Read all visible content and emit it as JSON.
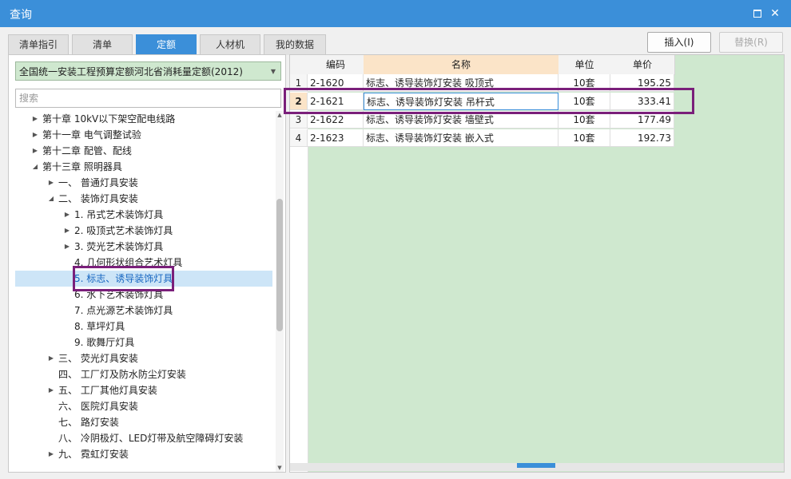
{
  "window": {
    "title": "查询",
    "title_bar_color": "#3b8fd9"
  },
  "tabs": [
    {
      "label": "清单指引",
      "active": false
    },
    {
      "label": "清单",
      "active": false
    },
    {
      "label": "定额",
      "active": true
    },
    {
      "label": "人材机",
      "active": false
    },
    {
      "label": "我的数据",
      "active": false
    }
  ],
  "toolbar": {
    "insert_label": "插入(I)",
    "replace_label": "替换(R)"
  },
  "library": {
    "selected": "全国统一安装工程预算定额河北省消耗量定额(2012)"
  },
  "search": {
    "placeholder": "搜索"
  },
  "tree": [
    {
      "label": "第十章 10kV以下架空配电线路",
      "expander": "collapsed"
    },
    {
      "label": "第十一章 电气调整试验",
      "expander": "collapsed"
    },
    {
      "label": "第十二章 配管、配线",
      "expander": "collapsed"
    },
    {
      "label": "第十三章 照明器具",
      "expander": "expanded"
    },
    {
      "label": "一、 普通灯具安装",
      "expander": "collapsed"
    },
    {
      "label": "二、 装饰灯具安装",
      "expander": "expanded"
    },
    {
      "label": "1. 吊式艺术装饰灯具",
      "expander": "collapsed"
    },
    {
      "label": "2. 吸顶式艺术装饰灯具",
      "expander": "collapsed"
    },
    {
      "label": "3. 荧光艺术装饰灯具",
      "expander": "collapsed"
    },
    {
      "label": "4. 几何形状组合艺术灯具",
      "expander": "none"
    },
    {
      "label": "5. 标志、诱导装饰灯具",
      "expander": "none",
      "selected": true
    },
    {
      "label": "6. 水下艺术装饰灯具",
      "expander": "none"
    },
    {
      "label": "7. 点光源艺术装饰灯具",
      "expander": "none"
    },
    {
      "label": "8. 草坪灯具",
      "expander": "none"
    },
    {
      "label": "9. 歌舞厅灯具",
      "expander": "none"
    },
    {
      "label": "三、 荧光灯具安装",
      "expander": "collapsed"
    },
    {
      "label": "四、 工厂灯及防水防尘灯安装",
      "expander": "none"
    },
    {
      "label": "五、 工厂其他灯具安装",
      "expander": "collapsed"
    },
    {
      "label": "六、 医院灯具安装",
      "expander": "none"
    },
    {
      "label": "七、 路灯安装",
      "expander": "none"
    },
    {
      "label": "八、 冷阴极灯、LED灯带及航空障碍灯安装",
      "expander": "none"
    },
    {
      "label": "九、 霓虹灯安装",
      "expander": "collapsed"
    }
  ],
  "grid": {
    "columns": [
      "编码",
      "名称",
      "单位",
      "单价"
    ],
    "rows": [
      {
        "no": "1",
        "code": "2-1620",
        "name": "标志、诱导装饰灯安装 吸顶式",
        "unit": "10套",
        "price": "195.25"
      },
      {
        "no": "2",
        "code": "2-1621",
        "name": "标志、诱导装饰灯安装 吊杆式",
        "unit": "10套",
        "price": "333.41"
      },
      {
        "no": "3",
        "code": "2-1622",
        "name": "标志、诱导装饰灯安装 墙壁式",
        "unit": "10套",
        "price": "177.49"
      },
      {
        "no": "4",
        "code": "2-1623",
        "name": "标志、诱导装饰灯安装 嵌入式",
        "unit": "10套",
        "price": "192.73"
      }
    ],
    "current_row": 2
  }
}
